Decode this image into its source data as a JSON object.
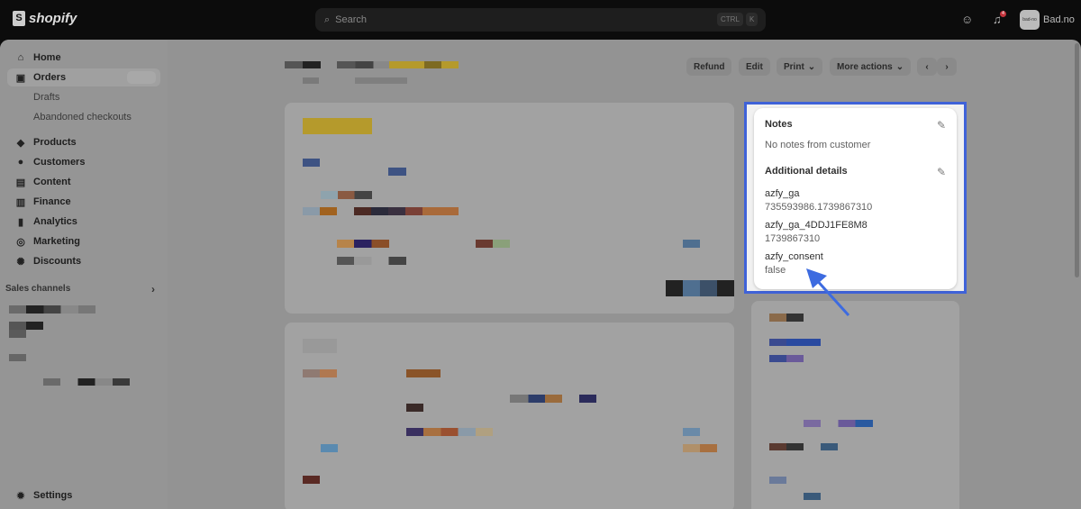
{
  "topbar": {
    "brand": "shopify",
    "search_placeholder": "Search",
    "shortcut_ctrl": "CTRL",
    "shortcut_k": "K",
    "notification_count": "4",
    "store_avatar": "bad-no",
    "store_name": "Bad.no"
  },
  "sidebar": {
    "items": [
      {
        "label": "Home",
        "icon": "⌂"
      },
      {
        "label": "Orders",
        "icon": "▣"
      },
      {
        "label": "Drafts"
      },
      {
        "label": "Abandoned checkouts"
      },
      {
        "label": "Products",
        "icon": "◆"
      },
      {
        "label": "Customers",
        "icon": "●"
      },
      {
        "label": "Content",
        "icon": "▤"
      },
      {
        "label": "Finance",
        "icon": "▥"
      },
      {
        "label": "Analytics",
        "icon": "▮"
      },
      {
        "label": "Marketing",
        "icon": "◎"
      },
      {
        "label": "Discounts",
        "icon": "✺"
      }
    ],
    "sales_channels": "Sales channels",
    "settings": "Settings"
  },
  "actions": {
    "refund": "Refund",
    "edit": "Edit",
    "print": "Print",
    "more": "More actions"
  },
  "notes": {
    "title": "Notes",
    "empty": "No notes from customer",
    "details_title": "Additional details",
    "details": [
      {
        "key": "azfy_ga",
        "value": "735593986.1739867310"
      },
      {
        "key": "azfy_ga_4DDJ1FE8M8",
        "value": "1739867310"
      },
      {
        "key": "azfy_consent",
        "value": "false"
      }
    ]
  },
  "colors": {
    "highlight": "#3f62d8",
    "arrow": "#3d6be0"
  }
}
